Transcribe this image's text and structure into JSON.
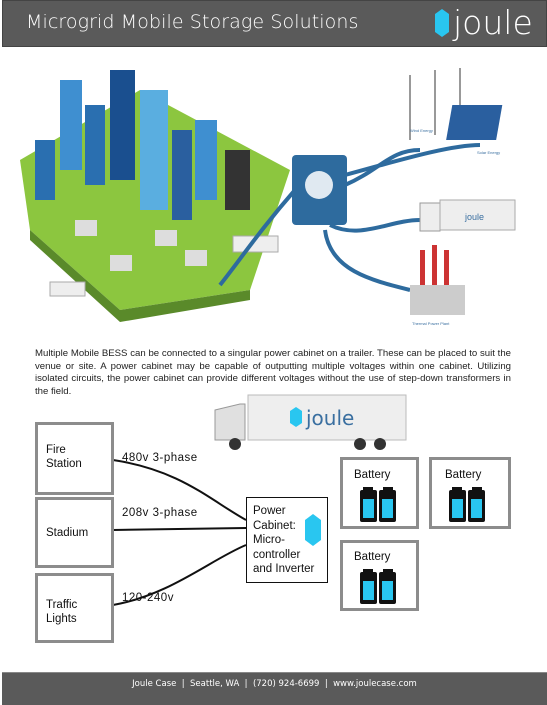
{
  "header": {
    "title": "Microgrid Mobile Storage Solutions",
    "logo_text": "joule"
  },
  "illustration": {
    "wind_label": "Wind Energy",
    "solar_label": "Solar Energy",
    "thermal_label": "Thermal Power Plant",
    "truck_logo": "joule"
  },
  "description": "Multiple Mobile BESS can be connected to a singular power cabinet on a trailer. These can be placed to suit the venue or site. A power cabinet may be capable of outputting multiple voltages within one cabinet. Utilizing isolated circuits, the power cabinet can provide different voltages without the use of step-down transformers in the field.",
  "diagram": {
    "truck_logo": "joule",
    "loads": [
      {
        "label": "Fire\nStation",
        "voltage": "480v 3-phase"
      },
      {
        "label": "Stadium",
        "voltage": "208v 3-phase"
      },
      {
        "label": "Traffic\nLights",
        "voltage": "120-240v"
      }
    ],
    "cabinet": {
      "label": "Power\nCabinet:\nMicro-\ncontroller\nand Inverter"
    },
    "batteries": [
      {
        "label": "Battery"
      },
      {
        "label": "Battery"
      },
      {
        "label": "Battery"
      }
    ]
  },
  "footer": {
    "text": "Joule Case  |  Seattle, WA  |  (720) 924-6699  |  www.joulecase.com"
  },
  "colors": {
    "header_bg": "#5a5a5a",
    "accent": "#29c6f0",
    "cable": "#2e6b9e"
  }
}
